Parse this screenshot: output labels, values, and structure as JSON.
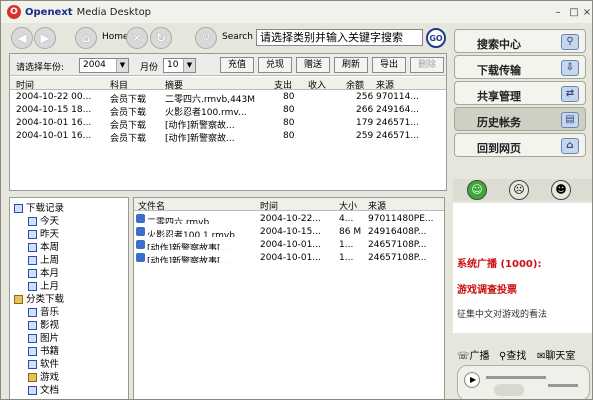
{
  "window": {
    "brand": "Openext",
    "title": "Media Desktop",
    "logo_glyph": "O",
    "controls": [
      "□",
      "–",
      "×"
    ]
  },
  "toolbar": {
    "home_label": "Home",
    "search_label": "Search",
    "search_value": "请选择类别并输入关键字搜索",
    "go_label": "GO"
  },
  "filter": {
    "year_label": "请选择年份:",
    "year_value": "2004",
    "month_label": "月份",
    "month_value": "10",
    "buttons": [
      {
        "label": "充值",
        "enabled": true
      },
      {
        "label": "兑现",
        "enabled": true
      },
      {
        "label": "赠送",
        "enabled": true
      },
      {
        "label": "刷新",
        "enabled": true
      },
      {
        "label": "导出",
        "enabled": true
      },
      {
        "label": "删除",
        "enabled": false
      }
    ]
  },
  "account_table": {
    "headers": [
      "时间",
      "科目",
      "摘要",
      "支出",
      "收入",
      "余额",
      "来源"
    ],
    "rows": [
      [
        "2004-10-22 00...",
        "会员下载",
        "二零四六.rmvb,443M",
        "80",
        "",
        "256",
        "970114..."
      ],
      [
        "2004-10-15 18...",
        "会员下载",
        "火影忍者100.rmv...",
        "80",
        "",
        "266",
        "249164..."
      ],
      [
        "2004-10-01 16...",
        "会员下载",
        "[动作]新警察故...",
        "80",
        "",
        "179",
        "246571..."
      ],
      [
        "2004-10-01 16...",
        "会员下载",
        "[动作]新警察故...",
        "80",
        "",
        "259",
        "246571..."
      ]
    ]
  },
  "tree": {
    "root": "下载记录",
    "periods": [
      "今天",
      "昨天",
      "本周",
      "上周",
      "本月",
      "上月"
    ],
    "category_root": "分类下载",
    "categories": [
      "音乐",
      "影视",
      "图片",
      "书籍",
      "软件",
      "游戏",
      "文档"
    ]
  },
  "file_table": {
    "headers": [
      "文件名",
      "时间",
      "大小",
      "来源"
    ],
    "rows": [
      [
        "二零四六.rmvb",
        "2004-10-22...",
        "4...",
        "97011480PE..."
      ],
      [
        "火影忍者100 1.rmvb",
        "2004-10-15...",
        "86 M",
        "24916408P..."
      ],
      [
        "[动作]新警察故事[...",
        "2004-10-01...",
        "1...",
        "24657108P..."
      ],
      [
        "[动作]新警察故事[...",
        "2004-10-01...",
        "1...",
        "24657108P..."
      ]
    ]
  },
  "nav": [
    {
      "label": "搜索中心",
      "icon": "search-icon",
      "glyph": "⚲",
      "active": false
    },
    {
      "label": "下载传输",
      "icon": "download-icon",
      "glyph": "⇩",
      "active": false
    },
    {
      "label": "共享管理",
      "icon": "share-icon",
      "glyph": "⇄",
      "active": false
    },
    {
      "label": "历史帐务",
      "icon": "history-icon",
      "glyph": "▤",
      "active": true
    },
    {
      "label": "回到网页",
      "icon": "home-icon",
      "glyph": "⌂",
      "active": false
    }
  ],
  "emoji": [
    {
      "name": "smile-face-icon",
      "glyph": "☺",
      "color": "#3aa83a"
    },
    {
      "name": "neutral-face-icon",
      "glyph": "☹",
      "color": "#e8e8e0"
    },
    {
      "name": "cool-face-icon",
      "glyph": "☻",
      "color": "#e8e8e0"
    }
  ],
  "news": {
    "line1": "系统广播 (1000):",
    "line2": "游戏调查投票",
    "line3": "征集中文对游戏的看法"
  },
  "bottom_links": [
    "广播",
    "查找",
    "聊天室"
  ],
  "colors": {
    "accent": "#1f3c8a",
    "highlight": "#cc1010"
  }
}
